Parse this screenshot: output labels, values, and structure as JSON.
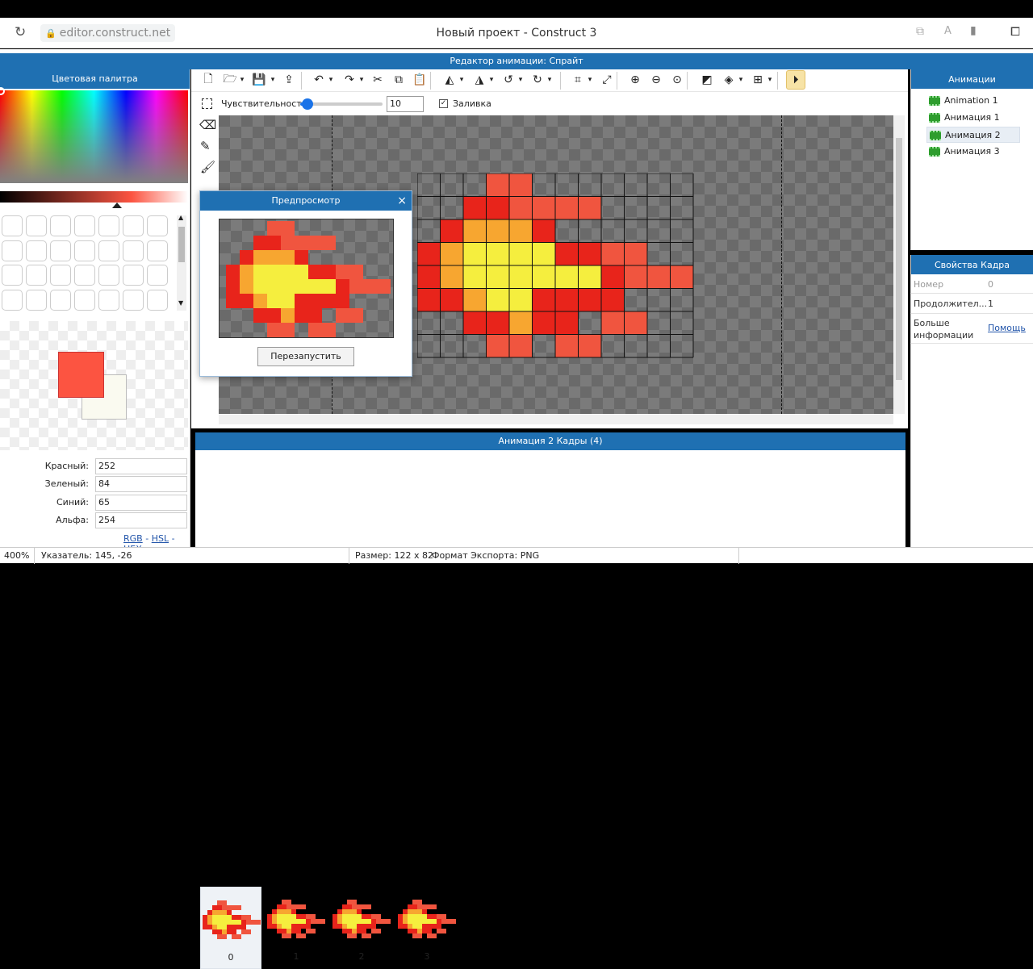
{
  "browser": {
    "url": "editor.construct.net",
    "title": "Новый проект - Construct 3"
  },
  "editor": {
    "title": "Редактор анимации: Спрайт",
    "sensitivity_label": "Чувствительность",
    "sensitivity_value": "10",
    "sensitivity_level": 0.05,
    "fill_label": "Заливка",
    "fill_checked": true
  },
  "palette": {
    "title": "Цветовая палитра",
    "primary_color": "#fc5441",
    "secondary_color": "#fafaf0",
    "red_label": "Красный:",
    "red": "252",
    "green_label": "Зеленый:",
    "green": "84",
    "blue_label": "Синий:",
    "blue": "65",
    "alpha_label": "Альфа:",
    "alpha": "254",
    "modes": [
      "RGB",
      "HSL",
      "HEX"
    ],
    "mode_sep": "-"
  },
  "preview": {
    "title": "Предпросмотр",
    "restart_label": "Перезапустить"
  },
  "animations": {
    "title": "Анимации",
    "items": [
      "Animation 1",
      "Анимация 1",
      "Анимация 2",
      "Анимация 3"
    ],
    "selected": 2
  },
  "frame_props": {
    "title": "Свойства Кадра",
    "rows": [
      {
        "label": "Номер",
        "value": "0"
      },
      {
        "label": "Продолжител...",
        "value": "1"
      },
      {
        "label": "Больше информации",
        "value": "Помощь"
      }
    ]
  },
  "frames": {
    "title": "Анимация 2 Кадры (4)",
    "items": [
      "0",
      "1",
      "2",
      "3"
    ],
    "selected": 0
  },
  "status": {
    "zoom": "400%",
    "pointer": "Указатель: 145, -26",
    "size": "Размер: 122 x 82",
    "export": "Формат Экспорта: PNG"
  },
  "colors": {
    "accent": "#1f70b2",
    "red": "#e8241b",
    "coral": "#f0553f",
    "orange": "#f7a630",
    "yellow": "#f5ee3e"
  }
}
